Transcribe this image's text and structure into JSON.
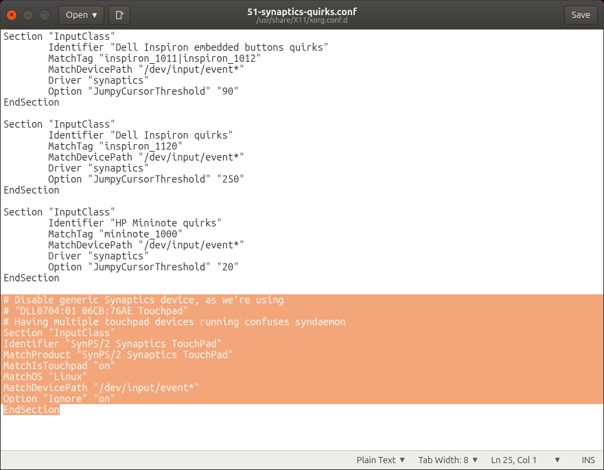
{
  "titlebar": {
    "title": "51-synaptics-quirks.conf",
    "subtitle": "/usr/share/X11/xorg.conf.d",
    "open_label": "Open",
    "save_label": "Save"
  },
  "editor": {
    "lines": [
      {
        "text": "Section \"InputClass\"",
        "selected": false
      },
      {
        "text": "        Identifier \"Dell Inspiron embedded buttons quirks\"",
        "selected": false
      },
      {
        "text": "        MatchTag \"inspiron_1011|inspiron_1012\"",
        "selected": false
      },
      {
        "text": "        MatchDevicePath \"/dev/input/event*\"",
        "selected": false
      },
      {
        "text": "        Driver \"synaptics\"",
        "selected": false
      },
      {
        "text": "        Option \"JumpyCursorThreshold\" \"90\"",
        "selected": false
      },
      {
        "text": "EndSection",
        "selected": false
      },
      {
        "text": "",
        "selected": false
      },
      {
        "text": "Section \"InputClass\"",
        "selected": false
      },
      {
        "text": "        Identifier \"Dell Inspiron quirks\"",
        "selected": false
      },
      {
        "text": "        MatchTag \"inspiron_1120\"",
        "selected": false
      },
      {
        "text": "        MatchDevicePath \"/dev/input/event*\"",
        "selected": false
      },
      {
        "text": "        Driver \"synaptics\"",
        "selected": false
      },
      {
        "text": "        Option \"JumpyCursorThreshold\" \"250\"",
        "selected": false
      },
      {
        "text": "EndSection",
        "selected": false
      },
      {
        "text": "",
        "selected": false
      },
      {
        "text": "Section \"InputClass\"",
        "selected": false
      },
      {
        "text": "        Identifier \"HP Mininote quirks\"",
        "selected": false
      },
      {
        "text": "        MatchTag \"mininote_1000\"",
        "selected": false
      },
      {
        "text": "        MatchDevicePath \"/dev/input/event*\"",
        "selected": false
      },
      {
        "text": "        Driver \"synaptics\"",
        "selected": false
      },
      {
        "text": "        Option \"JumpyCursorThreshold\" \"20\"",
        "selected": false
      },
      {
        "text": "EndSection",
        "selected": false
      },
      {
        "text": "",
        "selected": false
      },
      {
        "text": "# Disable generic Synaptics device, as we're using",
        "selected": true,
        "full": true
      },
      {
        "text": "# \"DLL0704:01 06CB:76AE Touchpad\"",
        "selected": true,
        "full": true
      },
      {
        "text": "# Having multiple touchpad devices running confuses syndaemon",
        "selected": true,
        "full": true
      },
      {
        "text": "Section \"InputClass\"",
        "selected": true,
        "full": true
      },
      {
        "text": "Identifier \"SynPS/2 Synaptics TouchPad\"",
        "selected": true,
        "full": true
      },
      {
        "text": "MatchProduct \"SynPS/2 Synaptics TouchPad\"",
        "selected": true,
        "full": true
      },
      {
        "text": "MatchIsTouchpad \"on\"",
        "selected": true,
        "full": true
      },
      {
        "text": "MatchOS \"Linux\"",
        "selected": true,
        "full": true
      },
      {
        "text": "MatchDevicePath \"/dev/input/event*\"",
        "selected": true,
        "full": true
      },
      {
        "text": "Option \"Ignore\" \"on\"",
        "selected": true,
        "full": true
      },
      {
        "text": "EndSection",
        "selected": true,
        "full": false
      }
    ]
  },
  "statusbar": {
    "syntax": "Plain Text",
    "tab_width": "Tab Width: 8",
    "position": "Ln 25, Col 1",
    "mode": "INS"
  }
}
